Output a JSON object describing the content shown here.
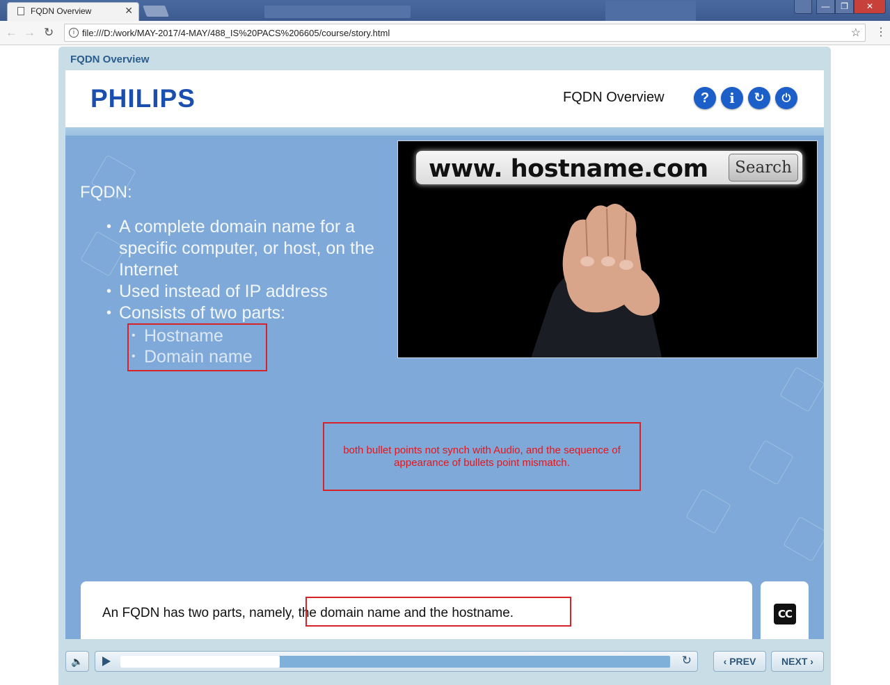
{
  "browser": {
    "tab_title": "FQDN Overview",
    "tab_close": "✕",
    "url": "file:///D:/work/MAY-2017/4-MAY/488_IS%20PACS%206605/course/story.html",
    "back_icon": "←",
    "forward_icon": "→",
    "reload_icon": "↻",
    "info_icon": "i",
    "star_icon": "☆",
    "menu_icon": "⋮",
    "win_user": "👤",
    "win_min": "—",
    "win_max": "❐",
    "win_close": "✕"
  },
  "player": {
    "title": "FQDN Overview",
    "header": {
      "logo": "PHILIPS",
      "title": "FQDN Overview",
      "help": "?",
      "info": "i",
      "replay": "↻",
      "exit": "⏻"
    },
    "slide": {
      "heading": "FQDN:",
      "bullets": [
        "A complete domain name for a specific computer, or host, on the Internet",
        "Used instead of IP address",
        "Consists of two parts:"
      ],
      "sub_bullets": [
        "Hostname",
        "Domain name"
      ],
      "image": {
        "search_text": "www. hostname.com",
        "search_button": "Search"
      },
      "review_note": "both bullet points not synch with Audio, and the sequence of appearance of bullets point mismatch."
    },
    "caption": {
      "text": "An FQDN has two parts, namely, the domain name and the hostname.",
      "cc_label": "CC"
    },
    "controls": {
      "volume_icon": "🔈",
      "progress": 0.29,
      "replay_icon": "↻",
      "prev_label": "‹ PREV",
      "next_label": "NEXT ›"
    }
  },
  "colors": {
    "brand_blue": "#1b4faf",
    "icon_blue": "#1c5fc9",
    "slide_bg": "#7ea9d8",
    "annotation_red": "#d6232a"
  }
}
